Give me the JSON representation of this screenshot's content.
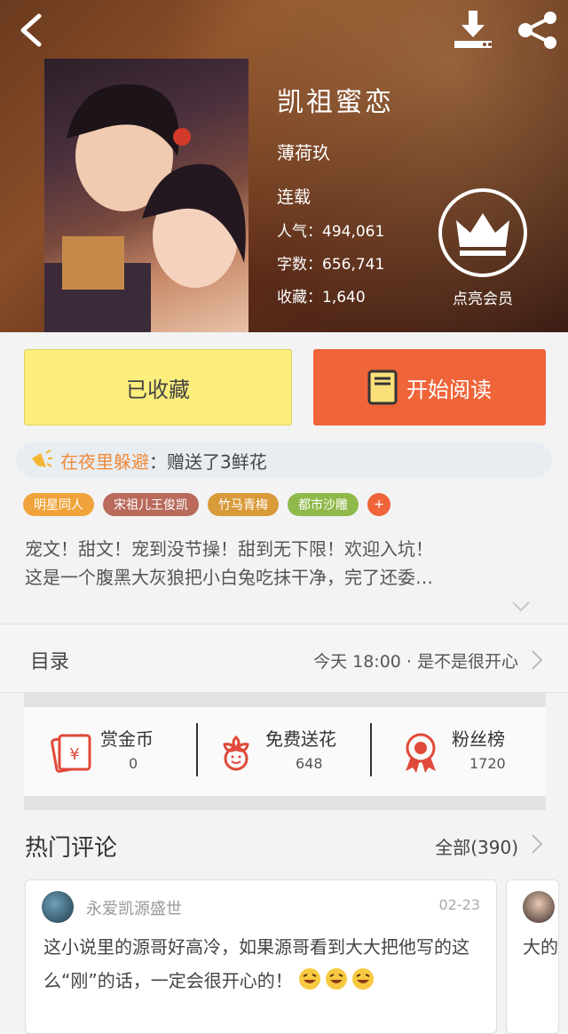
{
  "header": {
    "back_icon": "chevron-left-icon",
    "download_icon": "download-icon",
    "share_icon": "share-icon"
  },
  "book": {
    "title": "凯祖蜜恋",
    "author": "薄荷玖",
    "status": "连载",
    "popularity": "人气：494,061",
    "word_count": "字数：656,741",
    "favorites": "收藏：1,640",
    "vip_label": "点亮会员"
  },
  "buttons": {
    "favorited": "已收藏",
    "start_reading": "开始阅读"
  },
  "notice": {
    "user": "在夜里躲避",
    "message": "：赠送了3鲜花"
  },
  "tags": [
    {
      "label": "明星同人",
      "color": "#f0a33a"
    },
    {
      "label": "宋祖儿王俊凯",
      "color": "#b96a5a"
    },
    {
      "label": "竹马青梅",
      "color": "#d99a3a"
    },
    {
      "label": "都市沙雕",
      "color": "#8fb94a"
    },
    {
      "label": "+",
      "color": "#ef6439"
    }
  ],
  "description": {
    "line1": "宠文！甜文！宠到没节操！甜到无下限！欢迎入坑！",
    "line2": "这是一个腹黑大灰狼把小白兔吃抹干净，完了还委…"
  },
  "catalog": {
    "label": "目录",
    "latest": "今天 18:00 · 是不是很开心"
  },
  "actions": [
    {
      "title": "赏金币",
      "value": "0",
      "icon": "red-envelope-icon"
    },
    {
      "title": "免费送花",
      "value": "648",
      "icon": "flower-icon"
    },
    {
      "title": "粉丝榜",
      "value": "1720",
      "icon": "badge-icon"
    }
  ],
  "comments": {
    "title": "热门评论",
    "all": "全部(390)",
    "items": [
      {
        "user": "永爱凯源盛世",
        "date": "02-23",
        "text": "这小说里的源哥好高冷，如果源哥看到大大把他写的这么“刚”的话，一定会很开心的！"
      },
      {
        "user": "",
        "date": "",
        "text": "大的"
      }
    ]
  },
  "colors": {
    "accent": "#ef6439",
    "favorite_btn": "#fbee7c"
  }
}
